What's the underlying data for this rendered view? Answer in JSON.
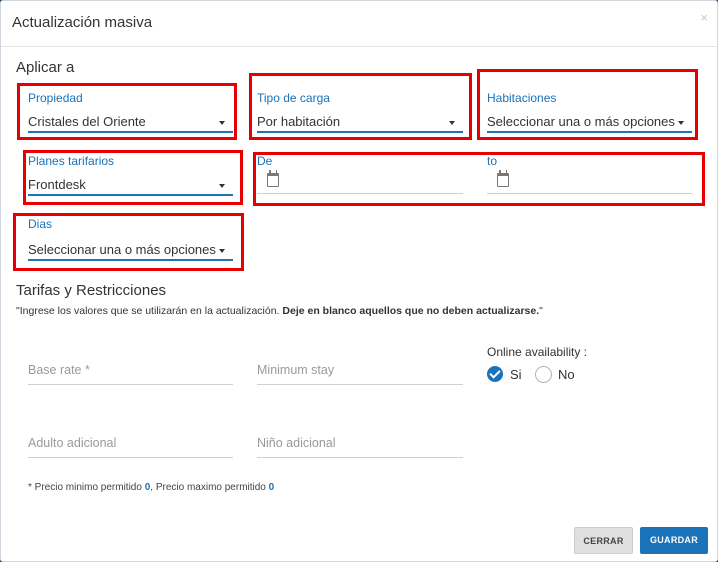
{
  "modal": {
    "title": "Actualización masiva",
    "close_icon": "×"
  },
  "apply": {
    "heading": "Aplicar a",
    "propiedad": {
      "label": "Propiedad",
      "value": "Cristales del Oriente"
    },
    "tipo_carga": {
      "label": "Tipo de carga",
      "value": "Por habitación"
    },
    "habitaciones": {
      "label": "Habitaciones",
      "value": "Seleccionar una o más opciones"
    },
    "planes": {
      "label": "Planes tarifarios",
      "value": "Frontdesk"
    },
    "de": {
      "label": "De",
      "value": ""
    },
    "to": {
      "label": "to",
      "value": ""
    },
    "dias": {
      "label": "Dias",
      "value": "Seleccionar una o más opciones"
    }
  },
  "rates": {
    "heading": "Tarifas y Restricciones",
    "note_prefix": "\"Ingrese los valores que se utilizarán en la actualización. ",
    "note_bold": "Deje en blanco aquellos que no deben actualizarse.",
    "note_suffix": "\"",
    "base_rate_placeholder": "Base rate *",
    "min_stay_placeholder": "Minimum stay",
    "adulto_placeholder": "Adulto adicional",
    "nino_placeholder": "Niño adicional",
    "availability": {
      "label": "Online availability :",
      "yes": "Si",
      "no": "No",
      "selected": "Si"
    },
    "footnote_a": "* Precio minimo permitido ",
    "footnote_min": "0",
    "footnote_b": ", Precio maximo permitido ",
    "footnote_max": "0"
  },
  "buttons": {
    "close": "CERRAR",
    "save": "GUARDAR"
  },
  "colors": {
    "accent": "#1a72b9",
    "highlight": "#e80000"
  }
}
